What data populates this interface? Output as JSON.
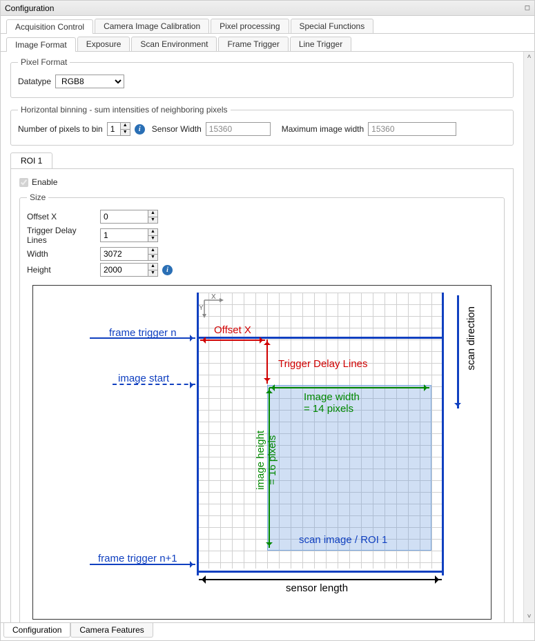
{
  "window": {
    "title": "Configuration"
  },
  "topTabs": {
    "acquisition": "Acquisition Control",
    "calibration": "Camera Image Calibration",
    "pixel": "Pixel processing",
    "special": "Special Functions"
  },
  "subTabs": {
    "imageFormat": "Image Format",
    "exposure": "Exposure",
    "scanEnv": "Scan Environment",
    "frameTrig": "Frame Trigger",
    "lineTrig": "Line Trigger"
  },
  "pixelFormat": {
    "legend": "Pixel Format",
    "datatypeLabel": "Datatype",
    "datatypeValue": "RGB8"
  },
  "binning": {
    "legend": "Horizontal binning - sum intensities of neighboring pixels",
    "numPixelsLabel": "Number of pixels to bin",
    "numPixelsValue": "1",
    "sensorWidthLabel": "Sensor Width",
    "sensorWidthValue": "15360",
    "maxImgWidthLabel": "Maximum image width",
    "maxImgWidthValue": "15360"
  },
  "roi": {
    "tabLabel": "ROI 1",
    "enableLabel": "Enable",
    "size": {
      "legend": "Size",
      "offsetX": {
        "label": "Offset X",
        "value": "0"
      },
      "triggerDelay": {
        "label": "Trigger Delay Lines",
        "value": "1"
      },
      "width": {
        "label": "Width",
        "value": "3072"
      },
      "height": {
        "label": "Height",
        "value": "2000"
      }
    }
  },
  "diagram": {
    "axisX": "X",
    "axisY": "Y",
    "frameTriggerN": "frame trigger n",
    "imageStart": "image start",
    "frameTriggerN1": "frame trigger n+1",
    "offsetX": "Offset X",
    "triggerDelayLines": "Trigger Delay Lines",
    "imageWidth": "Image width",
    "imageWidthVal": "= 14 pixels",
    "imageHeight": "image height",
    "imageHeightVal": "= 16 pixels",
    "roiLabel": "scan image / ROI 1",
    "sensorLength": "sensor length",
    "scanDirection": "scan direction"
  },
  "bottomTabs": {
    "config": "Configuration",
    "camFeat": "Camera Features"
  }
}
